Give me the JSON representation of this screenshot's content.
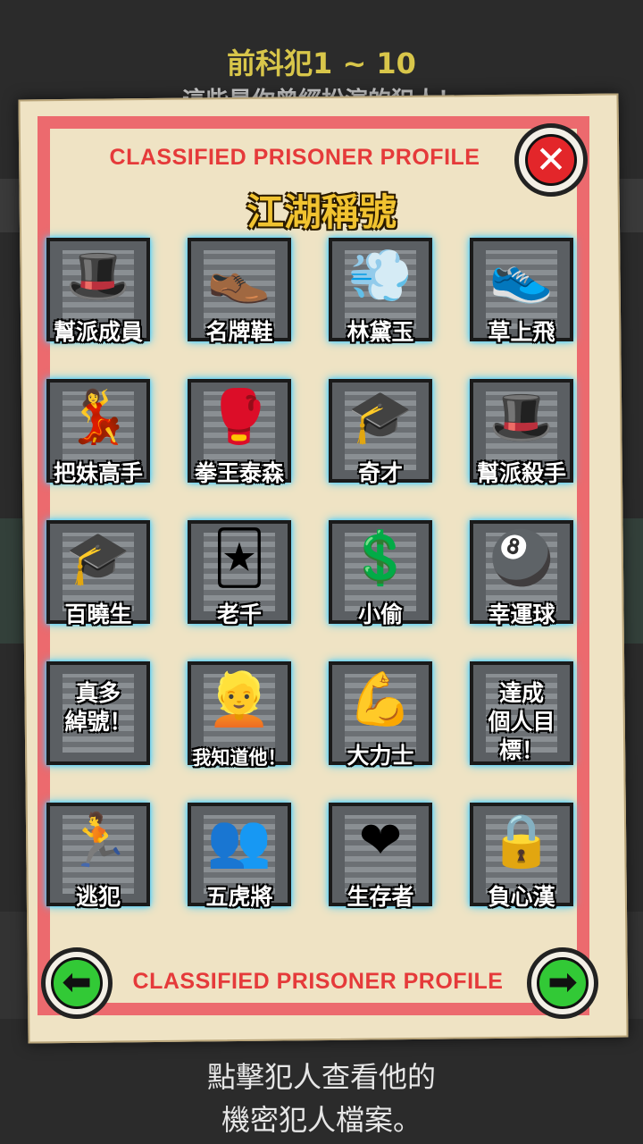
{
  "header": {
    "title": "前科犯1 ~ 10",
    "subtitle": "這些是你曾經扮演的犯人！"
  },
  "panel": {
    "top_banner": "CLASSIFIED PRISONER PROFILE",
    "section_title": "江湖稱號",
    "bottom_banner": "CLASSIFIED PRISONER PROFILE",
    "close_glyph": "✕",
    "prev_glyph": "⬅",
    "next_glyph": "➡"
  },
  "badges": [
    {
      "label": "幫派成員",
      "icon": "fedora-hat-icon",
      "glyph": "🎩"
    },
    {
      "label": "名牌鞋",
      "icon": "gold-shoe-icon",
      "glyph": "👞"
    },
    {
      "label": "林黛玉",
      "icon": "tissue-minus-icon",
      "glyph": "💨"
    },
    {
      "label": "草上飛",
      "icon": "old-man-shoe-icon",
      "glyph": "👟"
    },
    {
      "label": "把妹高手",
      "icon": "woman-heart-icon",
      "glyph": "💃"
    },
    {
      "label": "拳王泰森",
      "icon": "boxing-gloves-crown-icon",
      "glyph": "🥊"
    },
    {
      "label": "奇才",
      "icon": "graduation-cap-plus-icon",
      "glyph": "🎓"
    },
    {
      "label": "幫派殺手",
      "icon": "fedora-cigarette-icon",
      "glyph": "🎩"
    },
    {
      "label": "百曉生",
      "icon": "graduation-cap-icon",
      "glyph": "🎓"
    },
    {
      "label": "老千",
      "icon": "playing-cards-icon",
      "glyph": "🃏"
    },
    {
      "label": "小偷",
      "icon": "dollar-hand-icon",
      "glyph": "💲"
    },
    {
      "label": "幸運球",
      "icon": "eight-ball-icon",
      "glyph": "🎱"
    },
    {
      "label": "",
      "center": "真多\n綽號！",
      "icon": "stars-nicknames-icon",
      "glyph": ""
    },
    {
      "label": "我知道他！",
      "icon": "blonde-woman-icon",
      "glyph": "👱"
    },
    {
      "label": "大力士",
      "icon": "strongman-icon",
      "glyph": "💪"
    },
    {
      "label": "",
      "center": "達成\n個人目標！",
      "icon": "stars-goal-icon",
      "glyph": ""
    },
    {
      "label": "逃犯",
      "icon": "running-legs-icon",
      "glyph": "🏃"
    },
    {
      "label": "五虎將",
      "icon": "five-prisoners-icon",
      "glyph": "👥"
    },
    {
      "label": "生存者",
      "icon": "heart-cell-icon",
      "glyph": "❤"
    },
    {
      "label": "負心漢",
      "icon": "woman-behind-bars-icon",
      "glyph": "🔒"
    }
  ],
  "footer": {
    "line1": "點擊犯人查看他的",
    "line2": "機密犯人檔案。"
  }
}
